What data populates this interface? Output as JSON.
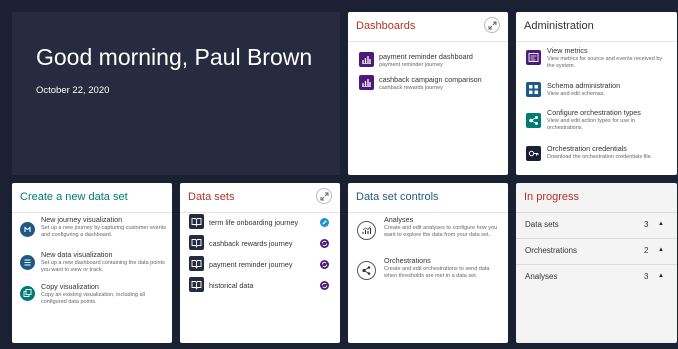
{
  "hero": {
    "greeting": "Good morning, Paul Brown",
    "date": "October 22, 2020"
  },
  "colors": {
    "navy": "#272b40",
    "purple": "#4e1a78",
    "teal": "#007a74",
    "blue_title": "#1c5a85",
    "red_title": "#b23328"
  },
  "dashboards": {
    "title": "Dashboards",
    "items": [
      {
        "name": "payment reminder dashboard",
        "sub": "payment reminder journey",
        "icon": "bar-chart-icon"
      },
      {
        "name": "cashback campaign comparison",
        "sub": "cashback rewards journey",
        "icon": "bar-chart-icon"
      }
    ]
  },
  "administration": {
    "title": "Administration",
    "items": [
      {
        "name": "View metrics",
        "sub": "View metrics for source and events received by the system.",
        "icon": "metrics-icon"
      },
      {
        "name": "Schema administration",
        "sub": "View and edit schemas.",
        "icon": "schema-icon"
      },
      {
        "name": "Configure orchestration types",
        "sub": "View and edit action types for use in orchestrations.",
        "icon": "orchestration-icon"
      },
      {
        "name": "Orchestration credentials",
        "sub": "Download the orchestration credentials file.",
        "icon": "key-icon"
      }
    ]
  },
  "create": {
    "title": "Create a new data set",
    "items": [
      {
        "name": "New journey visualization",
        "sub": "Set up a new journey by capturing customer events and configuring a dashboard.",
        "icon": "journey-icon"
      },
      {
        "name": "New data visualization",
        "sub": "Set up a new dashboard containing the data points you want to view or track.",
        "icon": "data-icon"
      },
      {
        "name": "Copy visualization",
        "sub": "Copy an existing visualization, including all configured data points.",
        "icon": "copy-icon"
      }
    ]
  },
  "datasets": {
    "title": "Data sets",
    "items": [
      {
        "name": "term life onboarding journey",
        "status": "edit-icon"
      },
      {
        "name": "cashback rewards journey",
        "status": "sync-icon"
      },
      {
        "name": "payment reminder journey",
        "status": "sync-icon"
      },
      {
        "name": "historical data",
        "status": "sync-icon"
      }
    ]
  },
  "controls": {
    "title": "Data set controls",
    "items": [
      {
        "name": "Analyses",
        "sub": "Create and edit analyses to configure how you want to explore the data from your data set.",
        "icon": "analyses-icon"
      },
      {
        "name": "Orchestrations",
        "sub": "Create and edit orchestrations to send data when thresholds are met in a data set.",
        "icon": "orchestrations-icon"
      }
    ]
  },
  "progress": {
    "title": "In progress",
    "items": [
      {
        "label": "Data sets",
        "count": "3"
      },
      {
        "label": "Orchestrations",
        "count": "2"
      },
      {
        "label": "Analyses",
        "count": "3"
      }
    ]
  }
}
